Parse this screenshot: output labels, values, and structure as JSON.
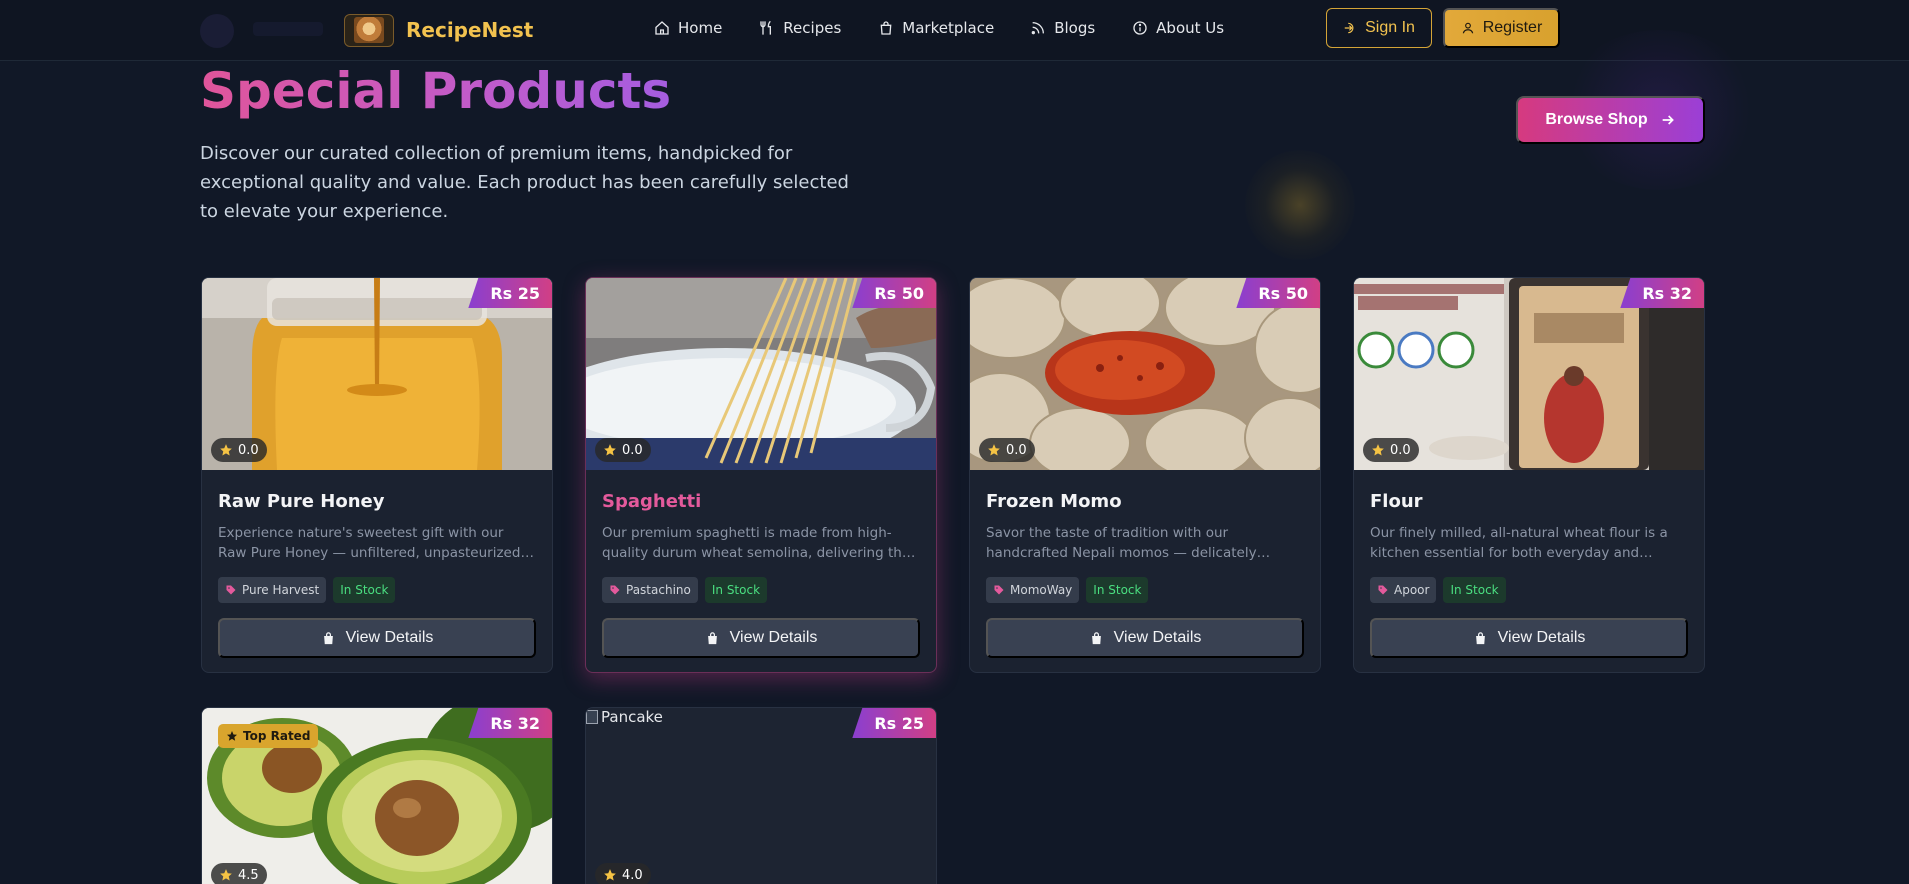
{
  "nav": {
    "brand": "RecipeNest",
    "links": [
      "Home",
      "Recipes",
      "Marketplace",
      "Blogs",
      "About Us"
    ],
    "sign_in": "Sign In",
    "register": "Register"
  },
  "hero": {
    "title": "Special Products",
    "description": "Discover our curated collection of premium items, handpicked for exceptional quality and value. Each product has been carefully selected to elevate your experience.",
    "browse_button": "Browse Shop"
  },
  "products": [
    {
      "name": "Raw Pure Honey",
      "price": "Rs 25",
      "rating": "0.0",
      "description": "Experience nature's sweetest gift with our Raw Pure Honey — unfiltered, unpasteurized, and packed with natural goodness.",
      "brand": "Pure Harvest",
      "stock": "In Stock",
      "action": "View Details"
    },
    {
      "name": "Spaghetti",
      "price": "Rs 50",
      "rating": "0.0",
      "description": "Our premium spaghetti is made from high-quality durum wheat semolina, delivering the perfect al dente bite.",
      "brand": "Pastachino",
      "stock": "In Stock",
      "action": "View Details"
    },
    {
      "name": "Frozen Momo",
      "price": "Rs 50",
      "rating": "0.0",
      "description": "Savor the taste of tradition with our handcrafted Nepali momos — delicately spiced dumplings filled with flavor.",
      "brand": "MomoWay",
      "stock": "In Stock",
      "action": "View Details"
    },
    {
      "name": "Flour",
      "price": "Rs 32",
      "rating": "0.0",
      "description": "Our finely milled, all-natural wheat flour is a kitchen essential for both everyday and gourmet baking.",
      "brand": "Apoor",
      "stock": "In Stock",
      "action": "View Details"
    },
    {
      "price": "Rs 32",
      "rating": "4.5",
      "badge": "Top Rated"
    },
    {
      "price": "Rs 25",
      "rating": "4.0",
      "image_alt": "Pancake"
    }
  ],
  "colors": {
    "background": "#111827",
    "brand_gold": "#f2c24f",
    "accent_pink": "#d63a7f",
    "accent_purple": "#9b3fd6",
    "in_stock_green": "#4ade80"
  }
}
